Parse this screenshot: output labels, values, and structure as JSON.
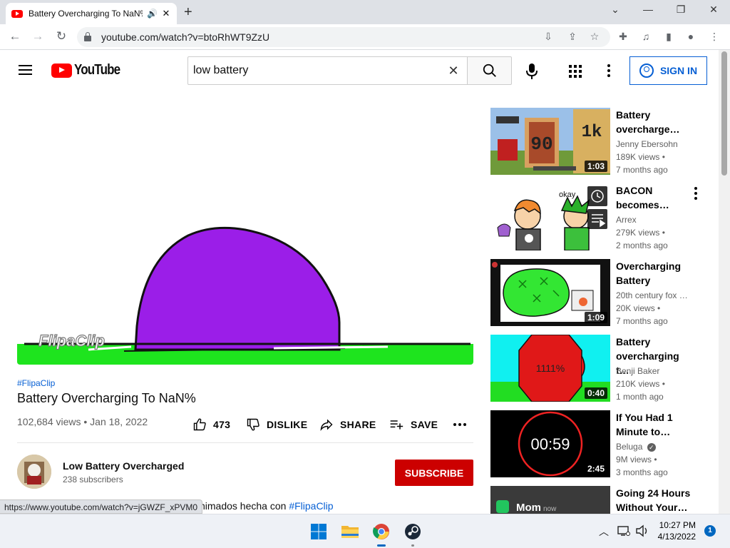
{
  "browser": {
    "tab_title": "Battery Overcharging To NaN%",
    "tab_audio_icon": "🔊",
    "tab_close": "✕",
    "new_tab": "+",
    "url": "youtube.com/watch?v=btoRhWT9ZzU",
    "status_url": "https://www.youtube.com/watch?v=jGWZF_xPVM0"
  },
  "youtube": {
    "logo_text": "YouTube",
    "search_value": "low battery",
    "search_clear": "✕",
    "sign_in": "SIGN IN",
    "accent": "#065fd4",
    "brand_red": "#ff0000"
  },
  "video": {
    "hashtag_top": "#FlipaClip",
    "title": "Battery Overcharging To NaN%",
    "meta": "102,684 views • Jan 18, 2022",
    "likes": "473",
    "dislike": "DISLIKE",
    "share": "SHARE",
    "save": "SAVE",
    "watermark": "FlipaClip",
    "channel_name": "Low Battery Overcharged",
    "channel_subs": "238 subscribers",
    "subscribe": "SUBSCRIBE",
    "desc_text": "nimados hecha con ",
    "desc_hashtag": "#FlipaClip"
  },
  "related": [
    {
      "title": "Battery overcharge…",
      "channel": "Jenny Ebersohn",
      "views": "189K views •",
      "age": "7 months ago",
      "duration": "1:03"
    },
    {
      "title": "BACON becomes…",
      "channel": "Arrex",
      "views": "279K views •",
      "age": "2 months ago",
      "duration": ""
    },
    {
      "title": "Overcharging Battery",
      "channel": "20th century fox …",
      "views": "20K views •",
      "age": "7 months ago",
      "duration": "1:09"
    },
    {
      "title": "Battery overcharging t…",
      "channel": "Benji Baker",
      "views": "210K views •",
      "age": "1 month ago",
      "duration": "0:40"
    },
    {
      "title": "If You Had 1 Minute to…",
      "channel": "Beluga",
      "views": "9M views •",
      "age": "3 months ago",
      "duration": "2:45"
    },
    {
      "title": "Going 24 Hours Without Your…",
      "channel": "",
      "views": "",
      "age": "",
      "duration": ""
    }
  ],
  "thumb_text": {
    "t1_big1": "90",
    "t1_big2": "1k",
    "t2_okay": "okay",
    "t4_value": "1111%",
    "t5_timer": "00:59",
    "t6_label": "Mom",
    "t6_now": "now"
  },
  "taskbar": {
    "time": "10:27 PM",
    "date": "4/13/2022",
    "notifications": "1"
  }
}
